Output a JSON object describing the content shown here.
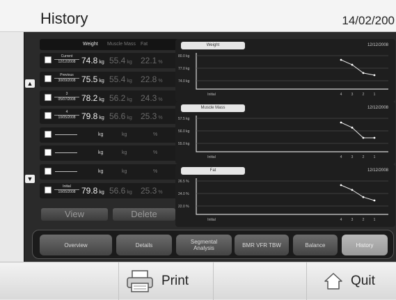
{
  "header": {
    "title": "History",
    "date": "14/02/200"
  },
  "table": {
    "columns": [
      "Weight",
      "Muscle Mass",
      "Fat"
    ],
    "rows": [
      {
        "top": "Current",
        "bottom": "12/12/2008",
        "weight": "74.8",
        "muscle": "55.4",
        "fat": "22.1"
      },
      {
        "top": "Previous",
        "bottom": "30/09/2008",
        "weight": "75.5",
        "muscle": "55.4",
        "fat": "22.8"
      },
      {
        "top": "3",
        "bottom": "05/07/2008",
        "weight": "78.2",
        "muscle": "56.2",
        "fat": "24.3"
      },
      {
        "top": "4",
        "bottom": "10/05/2008",
        "weight": "79.8",
        "muscle": "56.6",
        "fat": "25.3"
      },
      {
        "top": "",
        "bottom": "",
        "weight": "",
        "muscle": "",
        "fat": ""
      },
      {
        "top": "",
        "bottom": "",
        "weight": "",
        "muscle": "",
        "fat": ""
      },
      {
        "top": "",
        "bottom": "",
        "weight": "",
        "muscle": "",
        "fat": ""
      },
      {
        "top": "Initial",
        "bottom": "10/05/2008",
        "weight": "79.8",
        "muscle": "56.6",
        "fat": "25.3"
      }
    ],
    "units": {
      "kg": "kg",
      "pct": "%"
    },
    "view_label": "View",
    "delete_label": "Delete",
    "scroll_up": "▲",
    "scroll_down": "▼"
  },
  "charts": [
    {
      "title": "Weight",
      "date": "12/12/2008",
      "ylabels": [
        "80.0 kg",
        "77.0 kg",
        "74.0 kg"
      ],
      "xlabels": [
        "Initial",
        "4",
        "3",
        "2",
        "1"
      ]
    },
    {
      "title": "Muscle Mass",
      "date": "12/12/2008",
      "ylabels": [
        "57.5 kg",
        "56.0 kg",
        "55.0 kg"
      ],
      "xlabels": [
        "Initial",
        "4",
        "3",
        "2",
        "1"
      ]
    },
    {
      "title": "Fat",
      "date": "12/12/2008",
      "ylabels": [
        "26.5 %",
        "24.0 %",
        "22.0 %"
      ],
      "xlabels": [
        "Initial",
        "4",
        "3",
        "2",
        "1"
      ]
    }
  ],
  "chart_data": [
    {
      "type": "line",
      "title": "Weight",
      "x": [
        "Initial",
        "4",
        "3",
        "2",
        "1"
      ],
      "series": [
        {
          "values": [
            null,
            79.8,
            78.2,
            75.5,
            74.8
          ]
        }
      ]
    },
    {
      "type": "line",
      "title": "Muscle Mass",
      "x": [
        "Initial",
        "4",
        "3",
        "2",
        "1"
      ],
      "series": [
        {
          "values": [
            null,
            56.6,
            56.2,
            55.4,
            55.4
          ]
        }
      ]
    },
    {
      "type": "line",
      "title": "Fat",
      "x": [
        "Initial",
        "4",
        "3",
        "2",
        "1"
      ],
      "series": [
        {
          "values": [
            null,
            25.3,
            24.3,
            22.8,
            22.1
          ]
        }
      ]
    }
  ],
  "tabs": [
    {
      "label": "Overview",
      "active": false
    },
    {
      "label": "Details",
      "active": false
    },
    {
      "label": "Segmental Analysis",
      "active": false
    },
    {
      "label": "BMR VFR TBW",
      "active": false
    },
    {
      "label": "Balance",
      "active": false
    },
    {
      "label": "History",
      "active": true
    }
  ],
  "footer": {
    "print_label": "Print",
    "quit_label": "Quit"
  }
}
